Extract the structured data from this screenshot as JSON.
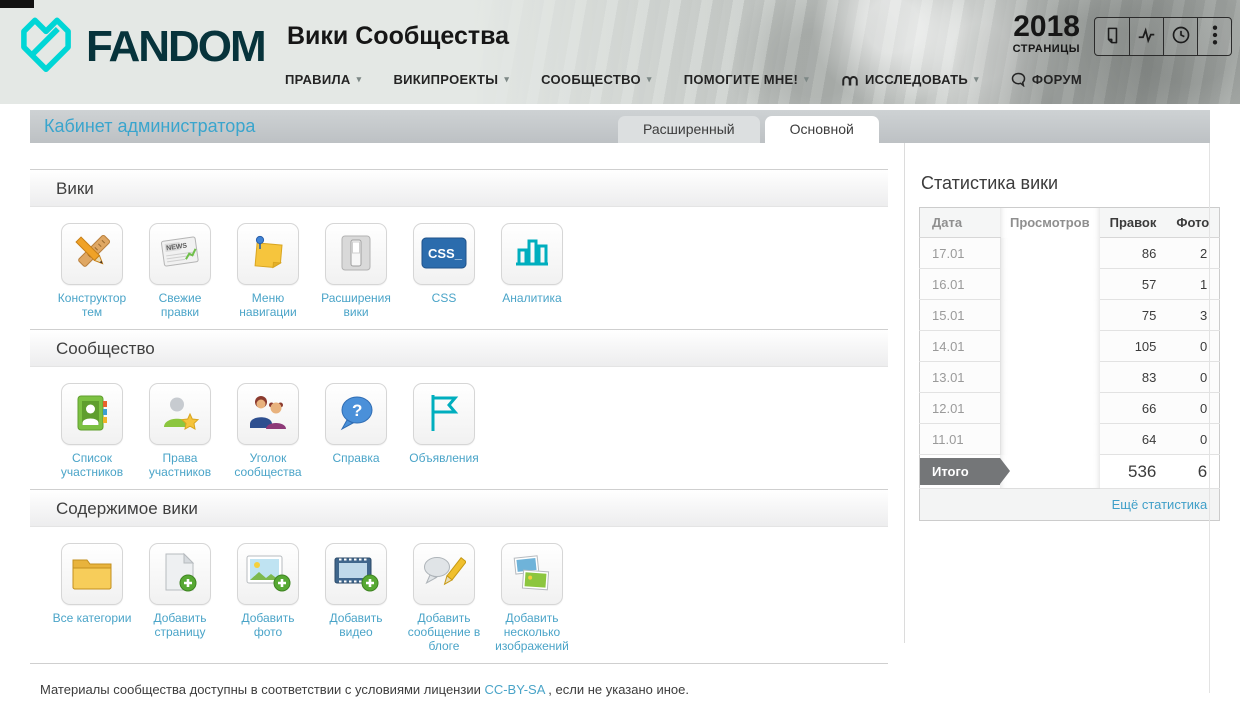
{
  "header": {
    "logo": "FANDOM",
    "wiki_title": "Вики Сообщества",
    "nav": [
      {
        "label": "ПРАВИЛА",
        "dropdown": true
      },
      {
        "label": "ВИКИПРОЕКТЫ",
        "dropdown": true
      },
      {
        "label": "СООБЩЕСТВО",
        "dropdown": true
      },
      {
        "label": "ПОМОГИТЕ МНЕ!",
        "dropdown": true
      },
      {
        "label": "ИССЛЕДОВАТЬ",
        "dropdown": true,
        "icon": "fandom-mark-icon"
      },
      {
        "label": "ФОРУМ",
        "dropdown": false,
        "icon": "speech-bubble-icon"
      }
    ],
    "page_counter": {
      "value": "2018",
      "label": "СТРАНИЦЫ"
    },
    "toolbar": [
      {
        "icon": "page-icon"
      },
      {
        "icon": "activity-icon"
      },
      {
        "icon": "clock-icon"
      },
      {
        "icon": "kebab-menu-icon"
      }
    ]
  },
  "page": {
    "title": "Кабинет администратора",
    "tabs": [
      {
        "label": "Расширенный",
        "active": false
      },
      {
        "label": "Основной",
        "active": true
      }
    ]
  },
  "sections": [
    {
      "title": "Вики",
      "tiles": [
        {
          "label": "Конструктор тем",
          "icon": "theme-designer-icon"
        },
        {
          "label": "Свежие правки",
          "icon": "recent-changes-icon"
        },
        {
          "label": "Меню навигации",
          "icon": "navigation-menu-icon"
        },
        {
          "label": "Расширения вики",
          "icon": "wiki-features-icon"
        },
        {
          "label": "CSS",
          "icon": "css-icon"
        },
        {
          "label": "Аналитика",
          "icon": "analytics-icon"
        }
      ]
    },
    {
      "title": "Сообщество",
      "tiles": [
        {
          "label": "Список участников",
          "icon": "member-list-icon"
        },
        {
          "label": "Права участников",
          "icon": "user-rights-icon"
        },
        {
          "label": "Уголок сообщества",
          "icon": "community-corner-icon"
        },
        {
          "label": "Справка",
          "icon": "help-icon"
        },
        {
          "label": "Объявления",
          "icon": "announcements-icon"
        }
      ]
    },
    {
      "title": "Содержимое вики",
      "tiles": [
        {
          "label": "Все категории",
          "icon": "all-categories-icon"
        },
        {
          "label": "Добавить страницу",
          "icon": "add-page-icon"
        },
        {
          "label": "Добавить фото",
          "icon": "add-photo-icon"
        },
        {
          "label": "Добавить видео",
          "icon": "add-video-icon"
        },
        {
          "label": "Добавить сообщение в блоге",
          "icon": "add-blog-post-icon"
        },
        {
          "label": "Добавить несколько изображений",
          "icon": "add-multiple-images-icon"
        }
      ]
    }
  ],
  "stats": {
    "title": "Статистика вики",
    "columns": [
      "Дата",
      "Просмотров",
      "Правок",
      "Фото"
    ],
    "rows": [
      {
        "date": "17.01",
        "views": "",
        "edits": "86",
        "photos": "2"
      },
      {
        "date": "16.01",
        "views": "",
        "edits": "57",
        "photos": "1"
      },
      {
        "date": "15.01",
        "views": "",
        "edits": "75",
        "photos": "3"
      },
      {
        "date": "14.01",
        "views": "",
        "edits": "105",
        "photos": "0"
      },
      {
        "date": "13.01",
        "views": "",
        "edits": "83",
        "photos": "0"
      },
      {
        "date": "12.01",
        "views": "",
        "edits": "66",
        "photos": "0"
      },
      {
        "date": "11.01",
        "views": "",
        "edits": "64",
        "photos": "0"
      }
    ],
    "total": {
      "label": "Итого",
      "views": "",
      "edits": "536",
      "photos": "6"
    },
    "more_link": "Ещё статистика"
  },
  "footer": {
    "text_before": "Материалы сообщества доступны в соответствии с условиями лицензии ",
    "license_link": "CC-BY-SA",
    "text_after": " , если не указано иное."
  },
  "colors": {
    "brand_teal": "#00d6d6",
    "wordmark_dark": "#07333b",
    "link_blue": "#4aa4c8",
    "page_title_blue": "#3aa5cd",
    "badge_gray": "#747678"
  }
}
